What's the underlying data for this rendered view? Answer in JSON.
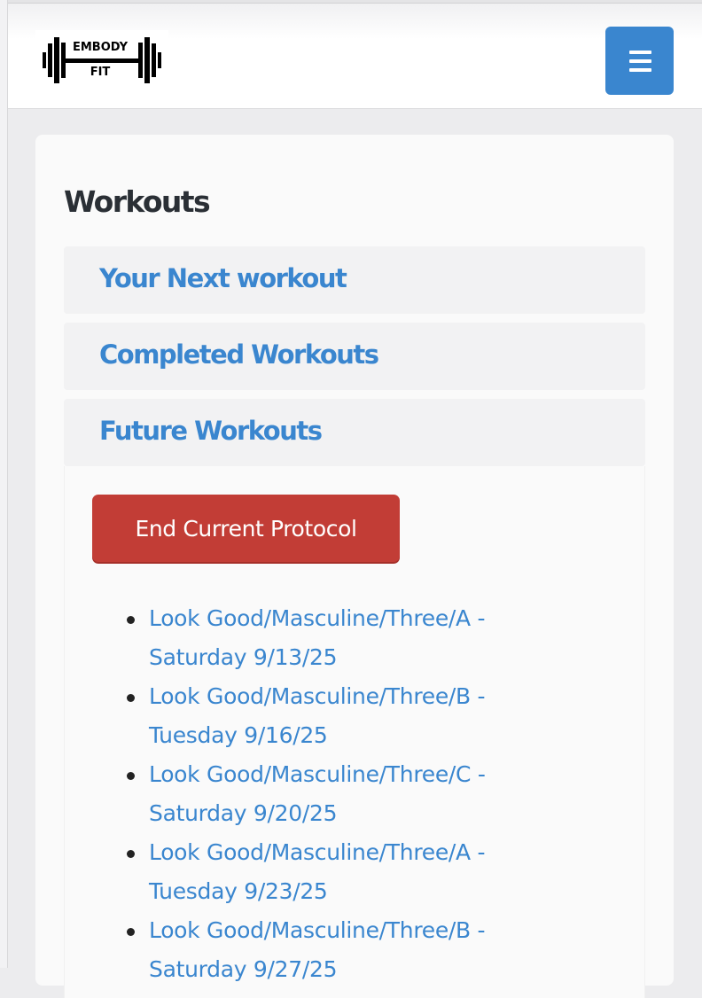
{
  "header": {
    "logo": {
      "line1": "EMBODY",
      "line2": "FIT",
      "icon": "barbell-icon"
    },
    "menu_icon": "hamburger-menu-icon",
    "menu_button_color": "#3a86cf"
  },
  "main": {
    "title": "Workouts",
    "sections": [
      {
        "label": "Your Next workout"
      },
      {
        "label": "Completed Workouts"
      },
      {
        "label": "Future Workouts"
      }
    ],
    "future": {
      "end_button_label": "End Current Protocol",
      "end_button_color": "#c23d36",
      "workouts": [
        {
          "label": "Look Good/Masculine/Three/A - Saturday 9/13/25"
        },
        {
          "label": "Look Good/Masculine/Three/B - Tuesday 9/16/25"
        },
        {
          "label": "Look Good/Masculine/Three/C - Saturday 9/20/25"
        },
        {
          "label": "Look Good/Masculine/Three/A - Tuesday 9/23/25"
        },
        {
          "label": "Look Good/Masculine/Three/B - Saturday 9/27/25"
        }
      ]
    }
  },
  "colors": {
    "accent": "#3a86cf",
    "danger": "#c23d36",
    "heading": "#2a2f35"
  }
}
